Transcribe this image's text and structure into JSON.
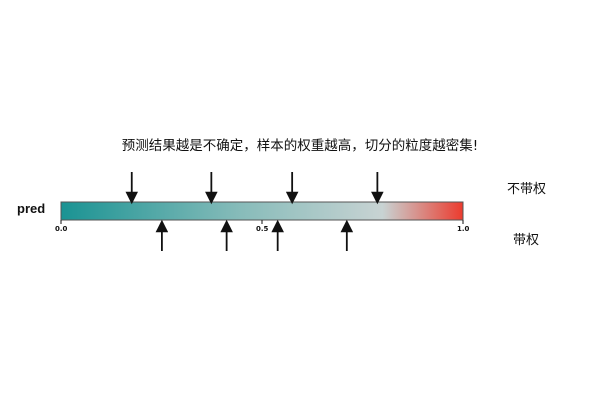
{
  "caption": "预测结果越是不确定，样本的权重越高，切分的粒度越密集!",
  "axis": {
    "label": "pred",
    "min": 0.0,
    "max": 1.0,
    "ticks": [
      {
        "value": 0.0,
        "text": "0.0"
      },
      {
        "value": 0.5,
        "text": "0.5"
      },
      {
        "value": 1.0,
        "text": "1.0"
      }
    ]
  },
  "gradient_colors": [
    "#1a9393",
    "#88bcba",
    "#c8d3d3",
    "#ec3b2e"
  ],
  "unweighted": {
    "label": "不带权",
    "split_points": [
      0.176,
      0.374,
      0.575,
      0.787
    ]
  },
  "weighted": {
    "label": "带权",
    "split_points": [
      0.251,
      0.412,
      0.539,
      0.711
    ]
  }
}
